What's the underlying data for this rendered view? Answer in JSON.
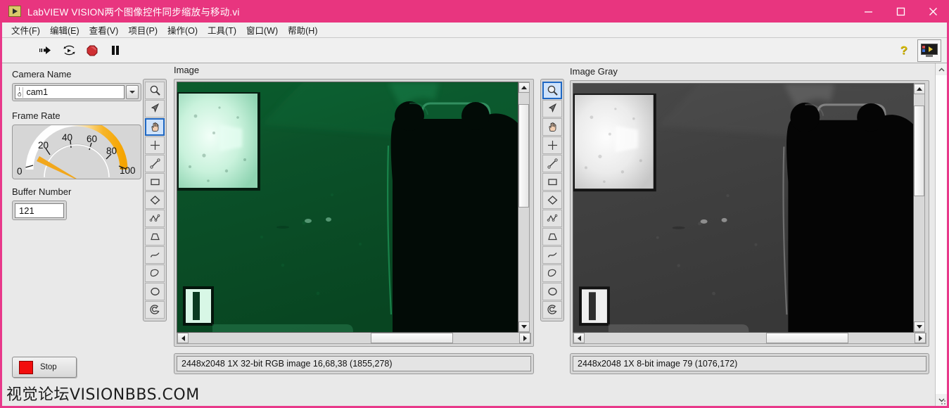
{
  "window": {
    "title": "LabVIEW VISION两个图像控件同步缩放与移动.vi",
    "accent_color": "#e8357f",
    "app_icon": "labview-vi-icon",
    "controls": {
      "minimize": "—",
      "maximize": "□",
      "close": "✕"
    }
  },
  "menubar": {
    "items": [
      {
        "label": "文件(F)",
        "name": "menu-file"
      },
      {
        "label": "编辑(E)",
        "name": "menu-edit"
      },
      {
        "label": "查看(V)",
        "name": "menu-view"
      },
      {
        "label": "项目(P)",
        "name": "menu-project"
      },
      {
        "label": "操作(O)",
        "name": "menu-operate"
      },
      {
        "label": "工具(T)",
        "name": "menu-tools"
      },
      {
        "label": "窗口(W)",
        "name": "menu-window"
      },
      {
        "label": "帮助(H)",
        "name": "menu-help"
      }
    ]
  },
  "toolbar": {
    "run_icon": "run-arrow-icon",
    "run_continuous_icon": "run-continuously-icon",
    "abort_icon": "abort-execution-icon",
    "pause_icon": "pause-icon",
    "help_icon": "context-help-question-icon",
    "show_diagram_icon": "show-block-diagram-icon"
  },
  "left_panel": {
    "camera_name": {
      "label": "Camera Name",
      "value": "cam1",
      "io_glyph": "io-refnum-icon",
      "dropdown_icon": "chevron-down-icon"
    },
    "frame_rate": {
      "label": "Frame Rate",
      "ticks": [
        "0",
        "20",
        "40",
        "60",
        "80",
        "100"
      ],
      "min": 0,
      "max": 100,
      "value": 15,
      "needle_color": "#f2a71b"
    },
    "buffer_number": {
      "label": "Buffer Number",
      "value": "121"
    },
    "stop_button": {
      "label": "Stop",
      "indicator_color": "#f20d0d"
    }
  },
  "watermark": {
    "text": "视觉论坛VISIONBBS.COM"
  },
  "tool_palette": {
    "tools": [
      {
        "name": "zoom-tool-icon",
        "title": "Zoom"
      },
      {
        "name": "selection-arrow-tool-icon",
        "title": "Select"
      },
      {
        "name": "pan-hand-tool-icon",
        "title": "Pan"
      },
      {
        "name": "point-crosshair-tool-icon",
        "title": "Point"
      },
      {
        "name": "line-tool-icon",
        "title": "Line"
      },
      {
        "name": "rectangle-tool-icon",
        "title": "Rectangle"
      },
      {
        "name": "rotated-rectangle-tool-icon",
        "title": "Rotated Rectangle"
      },
      {
        "name": "polyline-tool-icon",
        "title": "Polyline"
      },
      {
        "name": "polygon-tool-icon",
        "title": "Polygon"
      },
      {
        "name": "freehand-line-tool-icon",
        "title": "Freehand Line"
      },
      {
        "name": "freehand-region-tool-icon",
        "title": "Freehand Region"
      },
      {
        "name": "oval-tool-icon",
        "title": "Oval"
      },
      {
        "name": "annulus-tool-icon",
        "title": "Annulus"
      }
    ]
  },
  "image_color": {
    "label": "Image",
    "selected_tool_index": 2,
    "status": "2448x2048 1X 32-bit RGB image 16,68,38    (1855,278)",
    "scroll": {
      "v_thumb_pct": 5,
      "v_thumb_size_pct": 45,
      "h_thumb_pct": 55,
      "h_thumb_size_pct": 25
    }
  },
  "image_gray": {
    "label": "Image Gray",
    "selected_tool_index": 0,
    "status": "2448x2048 1X 8-bit image 79    (1076,172)",
    "scroll": {
      "v_thumb_pct": 5,
      "v_thumb_size_pct": 40,
      "h_thumb_pct": 55,
      "h_thumb_size_pct": 25
    }
  }
}
